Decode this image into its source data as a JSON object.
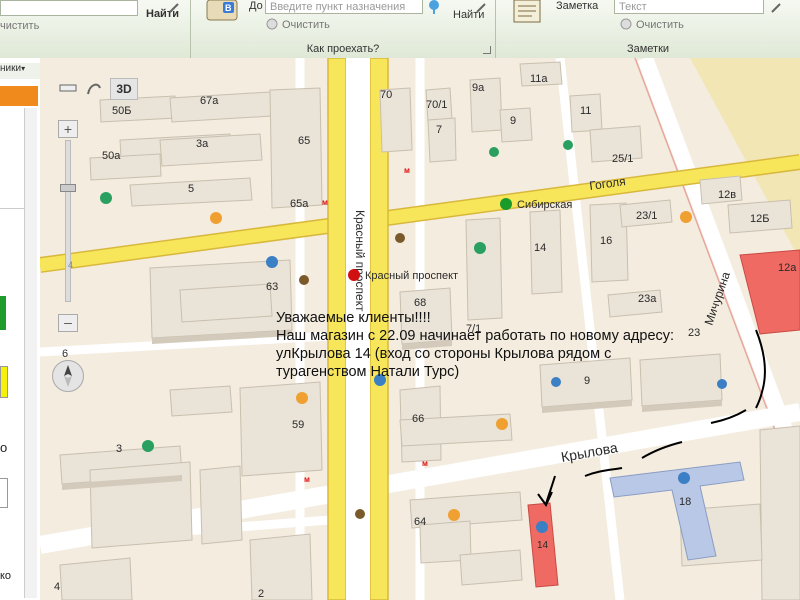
{
  "ribbon": {
    "search_group": {
      "find_label": "Найти",
      "clear_label": "чистить"
    },
    "route_group": {
      "from_label": "До",
      "destination_placeholder": "Введите пункт назначения",
      "clear_label": "Очистить",
      "find_label": "Найти",
      "group_label": "Как проехать?"
    },
    "notes_group": {
      "note_label": "Заметка",
      "text_placeholder": "Текст",
      "clear_label": "Очистить",
      "group_label": "Заметки"
    }
  },
  "left_panel": {
    "dropdown_label": "ники",
    "text_1": "о",
    "text_2": "ко"
  },
  "map_controls": {
    "mode_3d": "3D",
    "zoom_level": "6",
    "zoom_scale_label": "4"
  },
  "streets": {
    "krasny_prospekt": "Красный проспект",
    "gogolya": "Гоголя",
    "krylova": "Крылова",
    "michurina": "Мичурина"
  },
  "metro": {
    "sibirskaya": "Сибирская",
    "krasny_prospekt": "Красный проспект",
    "metro_symbol": "м"
  },
  "buildings": {
    "b70": "70",
    "b70_1": "70/1",
    "b7": "7",
    "b9a": "9а",
    "b11a": "11а",
    "b9": "9",
    "b11": "11",
    "b25_1": "25/1",
    "b50b": "50Б",
    "b67a": "67а",
    "b65": "65",
    "b65a": "65а",
    "b3a": "3а",
    "b50a": "50а",
    "b5": "5",
    "b63": "63",
    "b68": "68",
    "b7_1": "7/1",
    "b14": "14",
    "b16": "16",
    "b23_1": "23/1",
    "b23a": "23а",
    "b23": "23",
    "b12v": "12в",
    "b12b": "12Б",
    "b12a": "12а",
    "b9_bottom": "9",
    "b66": "66",
    "b59": "59",
    "b3": "3",
    "b64": "64",
    "b14_store": "14",
    "b18": "18",
    "b4": "4",
    "b2": "2"
  },
  "notice": {
    "line1": "Уважаемые клиенты!!!!",
    "line2": "Наш магазин с 22.09 начинает работать по новому адресу:",
    "line3": "улКрылова 14 (вход со стороны Крылова рядом с",
    "line4": "турагенством Натали Турс)"
  },
  "colors": {
    "main_road": "#f7e65a",
    "road_edge": "#d8b83c",
    "building": "#dcd4c6",
    "building_roof": "#e9e3d8",
    "store_highlight": "#ef6a62",
    "school_building": "#b9c8e6",
    "metro_red": "#d11111",
    "metro_green": "#1a9a2a",
    "ground": "#f3ecdf"
  }
}
